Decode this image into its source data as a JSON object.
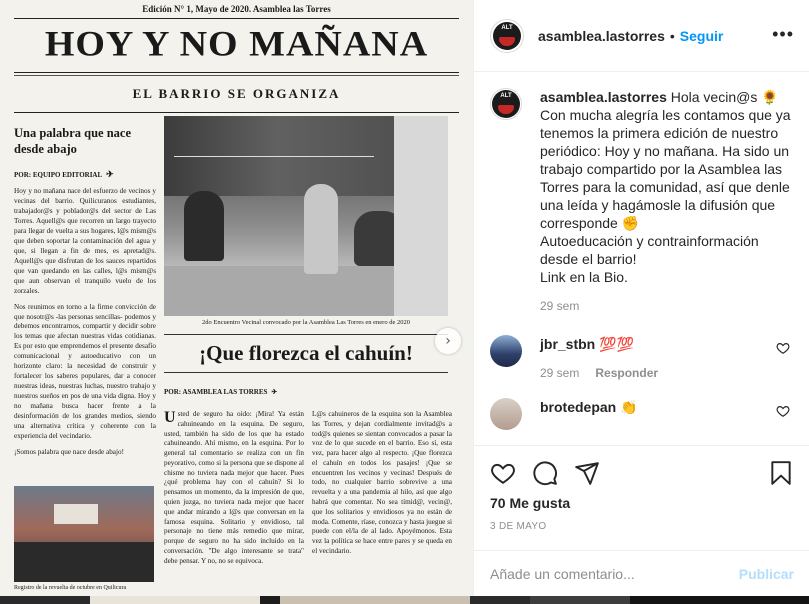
{
  "newspaper": {
    "edition": "Edición N° 1, Mayo de 2020. Asamblea las Torres",
    "masthead": "HOY Y NO MAÑANA",
    "subtitle": "EL BARRIO SE ORGANIZA",
    "article1_title": "Una palabra que nace desde abajo",
    "article1_byline": "POR: EQUIPO EDITORIAL",
    "article1_p1": "Hoy y no mañana nace del esfuerzo de vecinos y vecinas del barrio. Quilicuranos estudiantes, trabajador@s y poblador@s del sector de Las Torres. Aquell@s que recorren un largo trayecto para llegar de vuelta a sus hogares, l@s mism@s que deben soportar la contaminación del agua y que, si llegan a fin de mes, es apretad@s. Aquell@s que disfrutan de los sauces repartidos que van quedando en las calles, l@s mism@s que aun observan el tranquilo vuelo de los zorzales.",
    "article1_p2": "Nos reunimos en torno a la firme convicción de que nosotr@s -las personas sencillas- podemos y debemos encontrarnos, compartir y decidir sobre los temas que afectan nuestras vidas cotidianas. Es por esto que emprendemos el presente desafío comunicacional y autoeducativo con un horizonte claro: la necesidad de construir y fortalecer los saberes populares, dar a conocer nuestras ideas, nuestras luchas, nuestro trabajo y nuestros sueños en pos de una vida digna. Hoy y no mañana busca hacer frente a la desinformación de los grandes medios, siendo una alternativa crítica y coherente con la experiencia del vecindario.",
    "article1_p3": "¡Somos palabra que nace desde abajo!",
    "photo_top_caption": "2do Encuentro Vecinal convocado por la Asamblea Las Torres en enero de 2020",
    "headline2": "¡Que florezca el cahuín!",
    "byline2": "POR: ASAMBLEA LAS TORRES",
    "dropcap": "U",
    "col_mid": "sted de seguro ha oído: ¡Mira! Ya están cahuineando en la esquina. De seguro, usted, también ha sido de los que ha estado cahuineando. Ahí mismo, en la esquina. Por lo general tal comentario se realiza con un fin peyorativo, como si la persona que se dispone al chisme no tuviera nada mejor que hacer. Pues ¿qué problema hay con el cahuín? Si lo pensamos un momento, da la impresión de que, quien juzga, no tuviera nada mejor que hacer que andar mirando a l@s que conversan en la famosa esquina. Solitario y envidioso, tal personaje no tiene más remedio que mirar, porque de seguro no ha sido incluido en la conversación. \"De algo interesante se trata\" debe pensar. Y no, no se equivoca.",
    "col_right": "L@s cahuineros de la esquina son la Asamblea las Torres, y dejan cordialmente invitad@s a tod@s quienes se sientan convocados a pasar la voz de lo que sucede en el barrio. Eso sí, esta vez, para hacer algo al respecto. ¡Que florezca el cahuín en todos los pasajes! ¡Que se encuentren los vecinos y vecinas! Después de todo, no cualquier barrio sobrevive a una revuelta y a una pandemia al hilo, así que algo habrá que comentar. No sea tímid@, vecin@, que los solitarios y envidiosos ya no están de moda. Comente, ríase, conozca y hasta juegue si puede con el/la de al lado. Apoyémonos. Esta vez la política se hace entre pares y se queda en el vecindario.",
    "photo_bottom_caption": "Registro de la revuelta de octubre en Quilicura"
  },
  "post": {
    "account": "asamblea.lastorres",
    "separator": "•",
    "follow_label": "Seguir",
    "more_label": "•••",
    "avatar_text": "ALT",
    "caption_user": "asamblea.lastorres",
    "caption_lines": [
      "Hola vecin@s 🌻",
      "Con mucha alegría les contamos que ya tenemos la primera edición de nuestro periódico: Hoy y no mañana. Ha sido un trabajo compartido por la Asamblea las Torres para la comunidad, así que denle una leída y hagámosle la difusión que corresponde ✊",
      "Autoeducación y contrainformación desde el barrio!",
      "Link en la Bio."
    ],
    "caption_time": "29 sem",
    "comments": [
      {
        "user": "jbr_stbn",
        "text": "💯💯",
        "time": "29 sem",
        "reply": "Responder"
      },
      {
        "user": "brotedepan",
        "text": "👏"
      }
    ],
    "likes": "70 Me gusta",
    "date": "3 DE MAYO",
    "comment_placeholder": "Añade un comentario...",
    "publish_label": "Publicar"
  },
  "colors": {
    "accent": "#0095f6",
    "publish_disabled": "#b2dffc",
    "meta": "#8e8e8e",
    "text": "#262626"
  },
  "icons": [
    "heart-icon",
    "comment-icon",
    "share-icon",
    "bookmark-icon",
    "more-icon",
    "next-arrow-icon"
  ]
}
